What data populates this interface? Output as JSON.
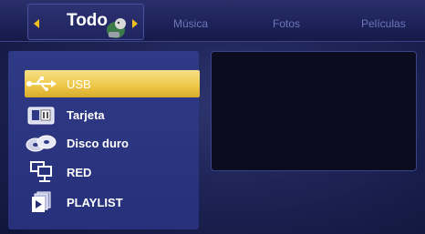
{
  "nav": {
    "active_tab": "Todo",
    "tabs": [
      "Música",
      "Fotos",
      "Películas"
    ]
  },
  "sources": [
    {
      "label": "USB",
      "icon": "usb-icon",
      "selected": true
    },
    {
      "label": "Tarjeta",
      "icon": "sd-card-icon",
      "selected": false
    },
    {
      "label": "Disco duro",
      "icon": "hard-disk-icon",
      "selected": false
    },
    {
      "label": "RED",
      "icon": "network-icon",
      "selected": false
    },
    {
      "label": "PLAYLIST",
      "icon": "playlist-icon",
      "selected": false
    }
  ],
  "colors": {
    "accent": "#f0c020",
    "selection": "#efc94a",
    "panel": "#2f3a86",
    "background": "#1e2456"
  }
}
